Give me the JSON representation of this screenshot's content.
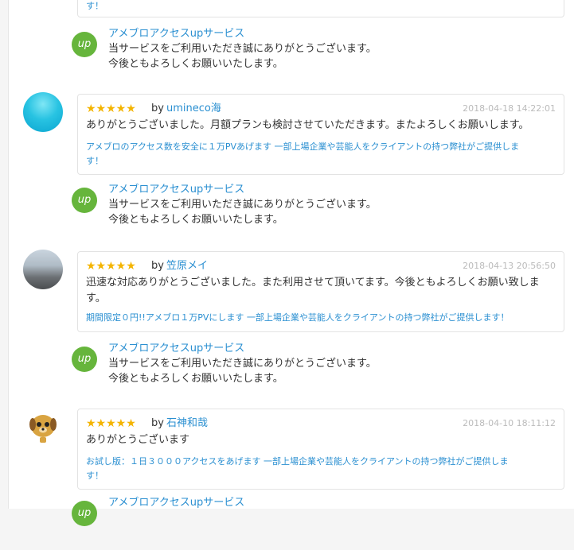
{
  "top_card_tail": "す！",
  "shop": {
    "name": "アメブロアクセスupサービス",
    "icon_text": "up"
  },
  "reply_text": [
    "当サービスをご利用いただき誠にありがとうございます。",
    "今後ともよろしくお願いいたします。"
  ],
  "reviews": [
    {
      "stars": "★★★★★",
      "by": "by",
      "user": "umineco海",
      "date": "2018-04-18 14:22:01",
      "comment": "ありがとうございました。月額プランも検討させていただきます。またよろしくお願いします。",
      "service_line1": "アメブロのアクセス数を安全に１万PVあげます 一部上場企業や芸能人をクライアントの持つ弊社がご提供しま",
      "service_line2": "す！"
    },
    {
      "stars": "★★★★★",
      "by": "by",
      "user": "笠原メイ",
      "date": "2018-04-13 20:56:50",
      "comment_line1": "迅速な対応ありがとうございました。また利用させて頂いてます。今後ともよろしくお願い致しま",
      "comment_line2": "す。",
      "service_line1": "期間限定０円!!アメブロ１万PVにします 一部上場企業や芸能人をクライアントの持つ弊社がご提供します！"
    },
    {
      "stars": "★★★★★",
      "by": "by",
      "user": "石神和哉",
      "date": "2018-04-10 18:11:12",
      "comment": "ありがとうございます",
      "service_line1": "お試し版：１日３０００アクセスをあげます 一部上場企業や芸能人をクライアントの持つ弊社がご提供しま",
      "service_line2": "す！"
    }
  ],
  "colors": {
    "link": "#2a8fd1",
    "star": "#f4b400",
    "shop_icon": "#66b53c"
  }
}
